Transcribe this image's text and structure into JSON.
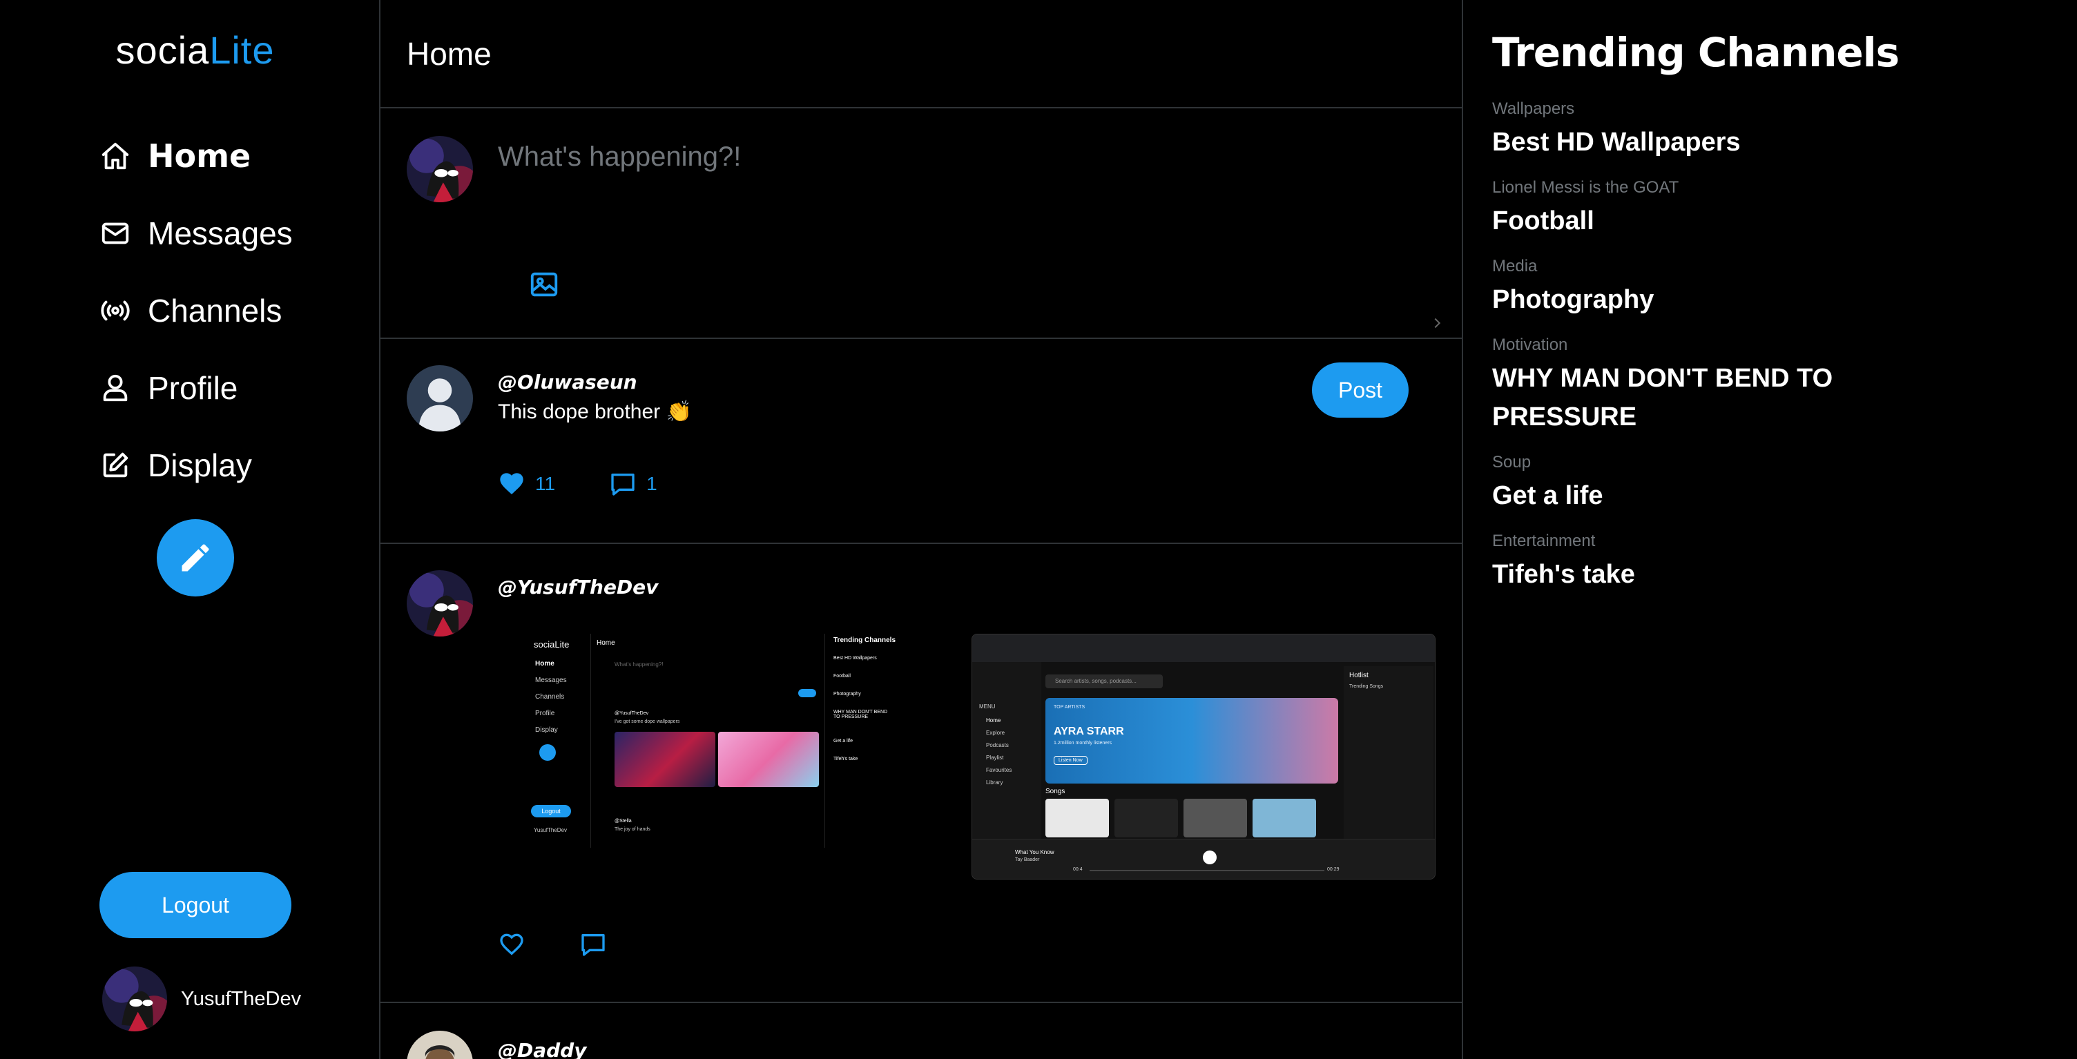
{
  "app": {
    "logo_main": "socia",
    "logo_accent": "Lite",
    "accent_color": "#1d9bf0"
  },
  "sidebar": {
    "items": [
      {
        "label": "Home",
        "icon": "home-icon",
        "active": true
      },
      {
        "label": "Messages",
        "icon": "mail-icon"
      },
      {
        "label": "Channels",
        "icon": "broadcast-icon"
      },
      {
        "label": "Profile",
        "icon": "user-icon"
      },
      {
        "label": "Display",
        "icon": "edit-square-icon"
      }
    ],
    "compose_icon": "pencil-icon",
    "logout_label": "Logout",
    "current_user": "YusufTheDev"
  },
  "main": {
    "title": "Home",
    "composer": {
      "placeholder": "What's happening?!",
      "image_icon": "image-icon",
      "post_label": "Post"
    },
    "posts": [
      {
        "handle": "@Oluwaseun",
        "text": "This dope brother 👏",
        "likes": "11",
        "comments": "1",
        "liked": true
      },
      {
        "handle": "@YusufTheDev",
        "text": "",
        "has_images": true
      },
      {
        "handle": "@Daddy"
      }
    ],
    "embedded_a": {
      "logo": "sociaLite",
      "nav": [
        "Home",
        "Messages",
        "Channels",
        "Profile",
        "Display"
      ],
      "title": "Home",
      "placeholder": "What's happening?!",
      "post_handle": "@YusufTheDev",
      "post_text": "I've got some dope wallpapers",
      "logout": "Logout",
      "user": "YusufTheDev",
      "reply_handle": "@Stella",
      "reply_text": "The joy of hands",
      "right_title": "Trending Channels",
      "right_items": [
        "Best HD Wallpapers",
        "Football",
        "Photography",
        "WHY MAN DON'T BEND TO PRESSURE",
        "Get a life",
        "Tifeh's take"
      ]
    },
    "embedded_b": {
      "search": "Search artists, songs, podcasts...",
      "banner_label": "TOP ARTISTS",
      "artist": "AYRA STARR",
      "listeners": "1.2million monthly listeners",
      "listen_btn": "Listen Now",
      "songs_label": "Songs",
      "hotlist": "Hotlist",
      "trending": "Trending Songs",
      "now_playing": "What You Know",
      "artist_small": "Tay Baader",
      "menu": [
        "MENU",
        "Home",
        "Explore",
        "Podcasts",
        "Playlist",
        "Favourites",
        "Library"
      ],
      "time_start": "00:4",
      "time_end": "00:29"
    }
  },
  "right": {
    "heading": "Trending Channels",
    "trends": [
      {
        "category": "Wallpapers",
        "name": "Best HD Wallpapers"
      },
      {
        "category": "Lionel Messi is the GOAT",
        "name": "Football"
      },
      {
        "category": "Media",
        "name": "Photography"
      },
      {
        "category": "Motivation",
        "name": "WHY MAN DON'T BEND TO PRESSURE"
      },
      {
        "category": "Soup",
        "name": "Get a life"
      },
      {
        "category": "Entertainment",
        "name": "Tifeh's take"
      }
    ]
  }
}
